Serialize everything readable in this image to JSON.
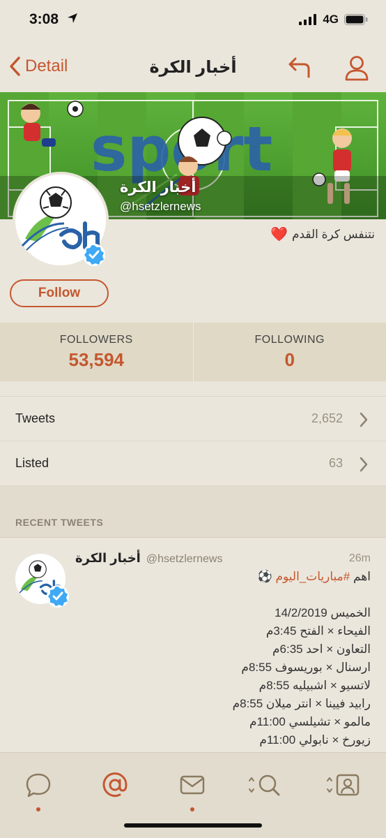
{
  "status_bar": {
    "time": "3:08",
    "network": "4G"
  },
  "nav": {
    "back_label": "Detail",
    "title": "أخبار الكرة"
  },
  "profile": {
    "name": "أخبار الكرة",
    "handle": "@hsetzlernews",
    "bio": "نتنفس كرة القدم",
    "bio_emoji": "❤️",
    "follow_label": "Follow",
    "banner_word": "sport"
  },
  "stats": {
    "followers_label": "FOLLOWERS",
    "followers_value": "53,594",
    "following_label": "FOLLOWING",
    "following_value": "0"
  },
  "lists": [
    {
      "label": "Tweets",
      "count": "2,652"
    },
    {
      "label": "Listed",
      "count": "63"
    }
  ],
  "recent_section_label": "RECENT TWEETS",
  "tweet": {
    "name": "أخبار الكرة",
    "handle": "@hsetzlernews",
    "time": "26m",
    "line1_prefix": "اهم",
    "line1_tag": "#مباريات_اليوم",
    "line1_emoji": "⚽",
    "lines": [
      "الخميس 14/2/2019",
      "الفيحاء × الفتح 3:45م",
      "التعاون × احد 6:35م",
      "ارسنال × بوريسوف 8:55م",
      "لاتسيو × اشبيليه 8:55م",
      "رابيد فيينا × انتر ميلان 8:55م",
      "مالمو × تشيلسي 11:00م",
      "زيورخ × نابولي 11:00م"
    ]
  },
  "colors": {
    "accent": "#c4572f",
    "background": "#ebe6dc",
    "stats_bg": "#e0d9c6",
    "verified": "#3fa9f5"
  },
  "icons": {
    "tabs": [
      "chat-bubble-icon",
      "mention-at-icon",
      "envelope-icon",
      "search-icon",
      "profile-card-icon"
    ]
  }
}
